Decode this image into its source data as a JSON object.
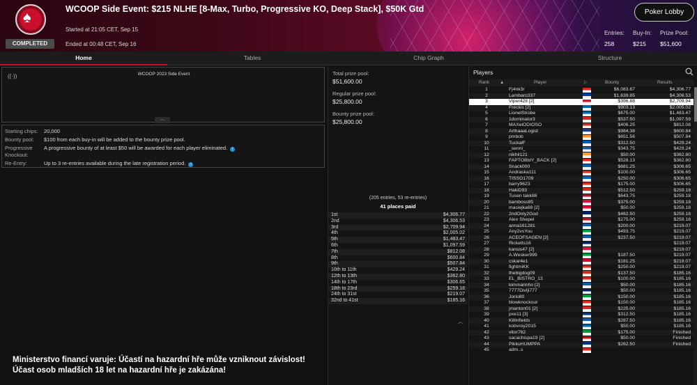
{
  "header": {
    "title": "WCOOP Side Event: $215 NLHE [8-Max, Turbo, Progressive KO, Deep Stack], $50K Gtd",
    "started": "Started at 21:05 CET, Sep 15",
    "ended": "Ended at 00:48 CET, Sep 16",
    "status": "COMPLETED",
    "lobby_button": "Poker Lobby",
    "entries_label": "Entries:",
    "entries_value": "258",
    "buyin_label": "Buy-In:",
    "buyin_value": "$215",
    "prize_label": "Prize Pool:",
    "prize_value": "$51,600"
  },
  "tabs": [
    "Home",
    "Tables",
    "Chip Graph",
    "Structure"
  ],
  "home": {
    "event_box_title": "WCOOP 2023 Side Event",
    "info": [
      {
        "label": "Starting chips:",
        "value": "20,000"
      },
      {
        "label": "Bounty pool:",
        "value": "$100 from each buy-in will be added to the bounty prize pool."
      },
      {
        "label": "Progressive",
        "value": "A progressive bounty of at least $50 will be awarded for each player eliminated."
      },
      {
        "label": "Knockout:",
        "value": ""
      },
      {
        "label": "Re-Entry:",
        "value": "Up to 3 re-entries available during the late registration period."
      }
    ],
    "warning_line1": "Ministerstvo financí varuje: Účastí na hazardní hře může vzniknout závislost!",
    "warning_line2": "Účast osob mladších 18 let na hazardní hře je zakázána!"
  },
  "prizes": {
    "total_label": "Total prize pool:",
    "total_value": "$51,600.00",
    "regular_label": "Regular prize pool:",
    "regular_value": "$25,800.00",
    "bounty_label": "Bounty prize pool:",
    "bounty_value": "$25,800.00",
    "entries_note": "(205 entries, 53 re-entries)",
    "places_paid": "41 places paid",
    "payouts": [
      [
        "1st",
        "$4,306.77"
      ],
      [
        "2nd",
        "$4,306.53"
      ],
      [
        "3rd",
        "$2,709.94"
      ],
      [
        "4th",
        "$2,005.02"
      ],
      [
        "5th",
        "$1,483.47"
      ],
      [
        "6th",
        "$1,097.59"
      ],
      [
        "7th",
        "$812.08"
      ],
      [
        "8th",
        "$600.84"
      ],
      [
        "9th",
        "$507.84"
      ],
      [
        "10th to 11th",
        "$429.24"
      ],
      [
        "12th to 13th",
        "$362.80"
      ],
      [
        "14th to 17th",
        "$306.65"
      ],
      [
        "18th to 23rd",
        "$259.18"
      ],
      [
        "24th to 31st",
        "$219.07"
      ],
      [
        "32nd to 41st",
        "$185.16"
      ]
    ]
  },
  "players": {
    "title": "Players",
    "head": {
      "rank": "Rank",
      "player": "Player",
      "bounty": "Bounty",
      "results": "Results"
    },
    "rows": [
      [
        "1",
        "Fj4nk3r",
        "$6,083.67",
        "$4,306.77",
        "#d52b1e"
      ],
      [
        "2",
        "Lambaro337",
        "$1,639.85",
        "$4,306.53",
        "#003da5"
      ],
      [
        "3",
        "Viper428 [2]",
        "$396.88",
        "$2,709.94",
        "#d7141a"
      ],
      [
        "4",
        "Freckis [2]",
        "$903.13",
        "$2,005.02",
        "#006aa7"
      ],
      [
        "5",
        "LionelStrobe",
        "$675.00",
        "$1,483.47",
        "#006aa7"
      ],
      [
        "6",
        "1dominator3",
        "$537.50",
        "$1,097.59",
        "#d52b1e"
      ],
      [
        "7",
        "MAXelODIOSO",
        "$406.25",
        "$812.08",
        "#d52b1e"
      ],
      [
        "8",
        "ArthaaaLogist",
        "$984.38",
        "$600.84",
        "#1a3a8a"
      ],
      [
        "9",
        "pmbob",
        "$651.56",
        "$507.84",
        "#ff9933"
      ],
      [
        "10",
        "TuckalF",
        "$312.50",
        "$429.24",
        "#0057b7"
      ],
      [
        "11",
        "_senni_",
        "$343.75",
        "$429.24",
        "#0d5eaf"
      ],
      [
        "12",
        "nikhil121",
        "$50.00",
        "$362.80",
        "#ff9933"
      ],
      [
        "13",
        "FAPTOBblY_BACK [2]",
        "$528.13",
        "$362.80",
        "#d52b1e"
      ],
      [
        "14",
        "Snack000",
        "$681.25",
        "$306.65",
        "#0d5eaf"
      ],
      [
        "15",
        "Andraska111",
        "$100.00",
        "$306.65",
        "#d52b1e"
      ],
      [
        "16",
        "TISSO1709",
        "$250.00",
        "$306.65",
        "#0d5eaf"
      ],
      [
        "17",
        "barry9623",
        "$175.00",
        "$306.65",
        "#d52b1e"
      ],
      [
        "18",
        "HakiD93",
        "$512.50",
        "$259.18",
        "#d52b1e"
      ],
      [
        "19",
        "Tusen takk88",
        "$643.75",
        "$259.18",
        "#ba0c2f"
      ],
      [
        "20",
        "bamboss85",
        "$375.00",
        "$259.18",
        "#dc143c"
      ],
      [
        "21",
        "maciejka69 [2]",
        "$50.00",
        "$259.18",
        "#dc143c"
      ],
      [
        "22",
        "2ndOnly2God",
        "$462.50",
        "$259.18",
        "#012169"
      ],
      [
        "23",
        "Alex Shepel",
        "$275.00",
        "$259.18",
        "#c60b1e"
      ],
      [
        "24",
        "anna161281",
        "$200.00",
        "$219.07",
        "#0d5eaf"
      ],
      [
        "25",
        "Any2vsYou",
        "$493.75",
        "$219.07",
        "#009c3b"
      ],
      [
        "26",
        "ACEOFSAGEN [2]",
        "$237.50",
        "$219.07",
        "#0d5eaf"
      ],
      [
        "27",
        "Ricketts16",
        "",
        "$219.07",
        "#012169"
      ],
      [
        "28",
        "kansis47 [2]",
        "",
        "$219.07",
        "#dc143c"
      ],
      [
        "29",
        "A.Wesker999",
        "$187.50",
        "$219.07",
        "#009c3b"
      ],
      [
        "30",
        "cskar4e1",
        "$181.25",
        "$219.07",
        "#c8102e"
      ],
      [
        "31",
        "fightmiKK",
        "$250.00",
        "$219.07",
        "#d52b1e"
      ],
      [
        "32",
        "thebigdog09",
        "$137.50",
        "$185.16",
        "#d52b1e"
      ],
      [
        "33",
        "EL_BISTRO_13",
        "$100.00",
        "$185.16",
        "#d52b1e"
      ],
      [
        "34",
        "kimmarinho [2]",
        "$50.00",
        "$185.16",
        "#0d5eaf"
      ],
      [
        "35",
        "7777Divlji777",
        "$50.00",
        "$185.16",
        "#012169"
      ],
      [
        "36",
        "Jorio80",
        "$150.00",
        "$185.16",
        "#009c3b"
      ],
      [
        "37",
        "blowknockout",
        "$150.00",
        "$185.16",
        "#d52b1e"
      ],
      [
        "38",
        "jmanton01 [2]",
        "$225.00",
        "$185.16",
        "#d52b1e"
      ],
      [
        "39",
        "pxe11 [3]",
        "$312.50",
        "$185.16",
        "#003580"
      ],
      [
        "40",
        "Killinfields",
        "$287.50",
        "$185.16",
        "#0d5eaf"
      ],
      [
        "41",
        "kobvroy2015",
        "$50.00",
        "$185.16",
        "#006aa7"
      ],
      [
        "42",
        "vitor762",
        "$175.00",
        "Finished",
        "#009c3b"
      ],
      [
        "43",
        "sacachispa19 [2]",
        "$50.00",
        "Finished",
        "#c60b1e"
      ],
      [
        "44",
        "PikkuHUMPPA",
        "$262.50",
        "Finished",
        "#003580"
      ],
      [
        "45",
        "adm..s",
        "",
        "",
        "#d52b1e"
      ]
    ]
  },
  "colors": {
    "accent": "#c8102e",
    "highlight_row": "#ffffff"
  },
  "icons": [
    "broadcast-icon",
    "search-icon",
    "info-icon",
    "sort-up-icon",
    "flag-icon",
    "spade-icon"
  ]
}
